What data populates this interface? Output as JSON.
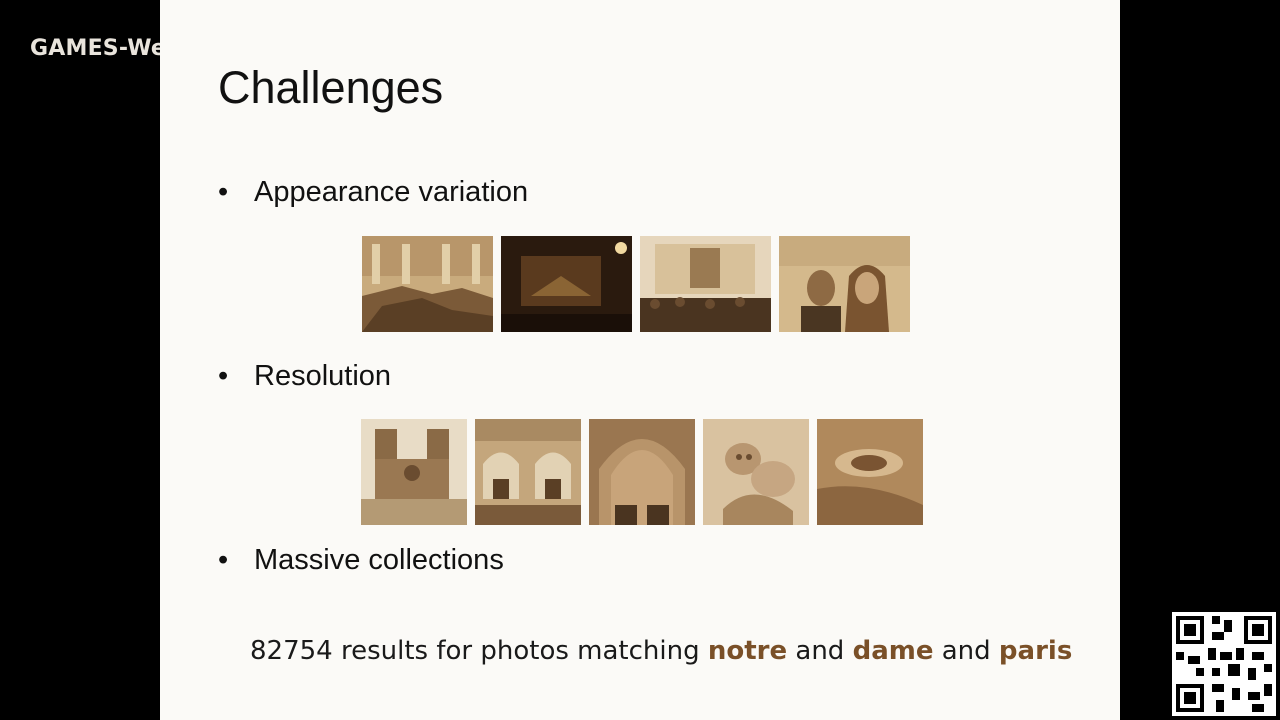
{
  "watermark": "GAMES-We",
  "slide": {
    "title": "Challenges",
    "bullets": [
      {
        "marker": "•",
        "text": "Appearance variation"
      },
      {
        "marker": "•",
        "text": "Resolution"
      },
      {
        "marker": "•",
        "text": "Massive collections"
      }
    ],
    "appearance_images": [
      "trevi-fountain-day",
      "trevi-fountain-night",
      "trevi-fountain-crowd",
      "trevi-fountain-selfie"
    ],
    "resolution_images": [
      "notre-dame-facade",
      "notre-dame-portals",
      "notre-dame-arch",
      "notre-dame-sculpture",
      "notre-dame-detail"
    ],
    "caption": {
      "prefix": "82754 results for photos matching ",
      "kw1": "notre",
      "and1": " and ",
      "kw2": "dame",
      "and2": " and ",
      "kw3": "paris"
    }
  },
  "colors": {
    "keyword": "#7a5028",
    "sepia": "#a07850"
  }
}
